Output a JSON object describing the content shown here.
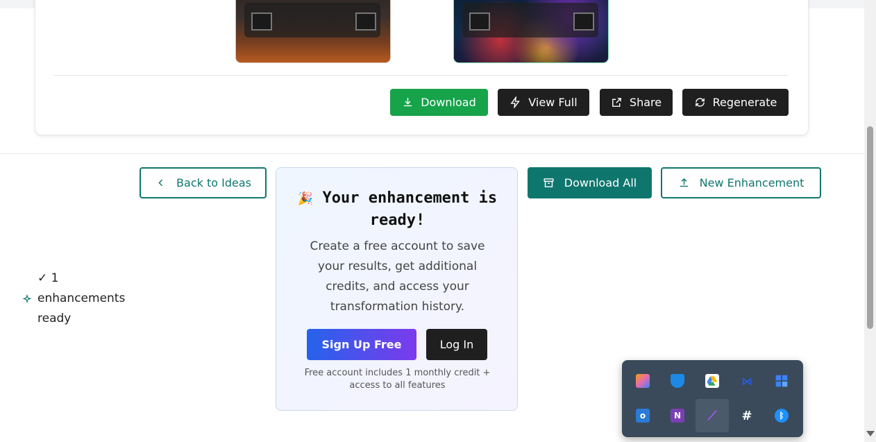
{
  "card": {
    "actions": {
      "download": "Download",
      "view_full": "View Full",
      "share": "Share",
      "regenerate": "Regenerate"
    },
    "colors": {
      "download_bg": "#16a34a",
      "dark_bg": "#1f1f1f"
    }
  },
  "toolbar": {
    "back": "Back to Ideas",
    "download_all": "Download All",
    "new_enhancement": "New Enhancement",
    "accent": "#0f766e"
  },
  "status": {
    "text": "✓ 1 enhancements ready",
    "icon": "sparkle-icon"
  },
  "modal": {
    "emoji": "🎉",
    "title": "Your enhancement is ready!",
    "body": "Create a free account to save your results, get additional credits, and access your transformation history.",
    "signup": "Sign Up Free",
    "login": "Log In",
    "footnote": "Free account includes 1 monthly credit + access to all features"
  },
  "tray": {
    "icons": [
      {
        "name": "copilot-icon",
        "color": "#e56ab3"
      },
      {
        "name": "defender-icon",
        "color": "#1e88e5"
      },
      {
        "name": "google-drive-icon",
        "color": "#34a853"
      },
      {
        "name": "meet-icon",
        "color": "#2d5bd6"
      },
      {
        "name": "grid-app-icon",
        "color": "#3b82f6"
      },
      {
        "name": "outlook-icon",
        "color": "#2b7bd6"
      },
      {
        "name": "onenote-icon",
        "color": "#7b3fb5"
      },
      {
        "name": "feather-app-icon",
        "color": "#a855f7"
      },
      {
        "name": "slack-icon",
        "color": "#ffffff"
      },
      {
        "name": "bluetooth-icon",
        "color": "#1e90ff"
      }
    ]
  }
}
